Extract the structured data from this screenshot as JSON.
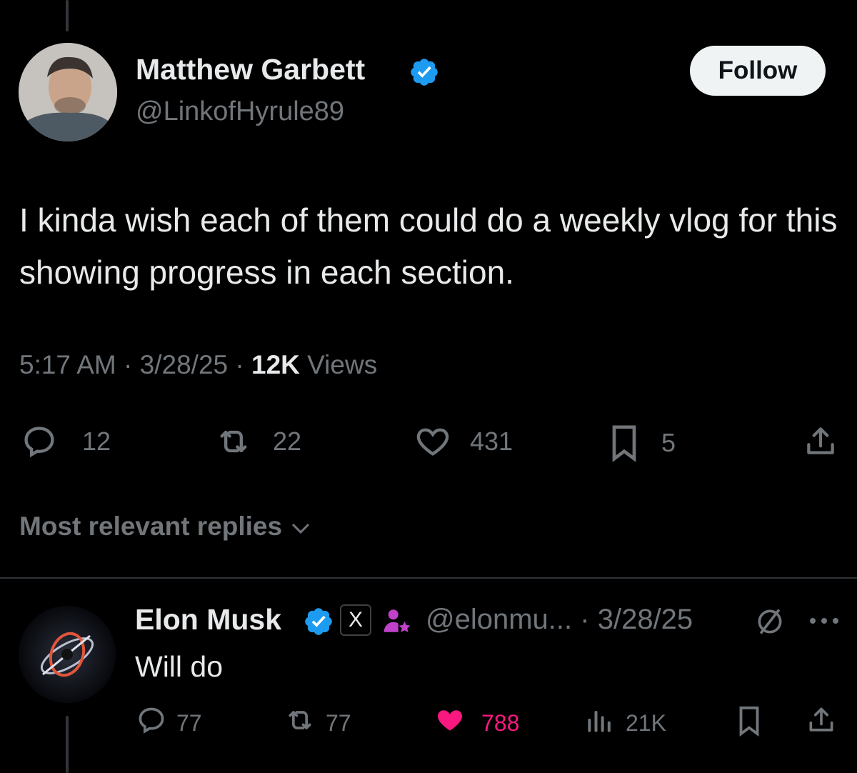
{
  "tweet": {
    "author_name": "Matthew Garbett",
    "author_handle": "@LinkofHyrule89",
    "follow_label": "Follow",
    "text": "I kinda wish each of them could do a weekly vlog for this showing progress in each section.",
    "time": "5:17 AM",
    "date": "3/28/25",
    "views_count": "12K",
    "views_label": "Views",
    "separator": "·",
    "stats": {
      "replies": "12",
      "reposts": "22",
      "likes": "431",
      "bookmarks": "5"
    }
  },
  "sort_label": "Most relevant replies",
  "reply": {
    "author_name": "Elon Musk",
    "affiliate_badge": "X",
    "handle": "@elonmu...",
    "separator": "·",
    "date": "3/28/25",
    "text": "Will do",
    "stats": {
      "replies": "77",
      "reposts": "77",
      "likes": "788",
      "views": "21K"
    }
  },
  "colors": {
    "verified": "#1d9bf0",
    "like_active": "#f91880",
    "affiliate": "#c042c9"
  },
  "icons": [
    "reply-icon",
    "repost-icon",
    "like-icon",
    "bookmark-icon",
    "share-icon",
    "views-icon",
    "grok-icon",
    "more-icon",
    "verified-icon",
    "chevron-down-icon"
  ]
}
